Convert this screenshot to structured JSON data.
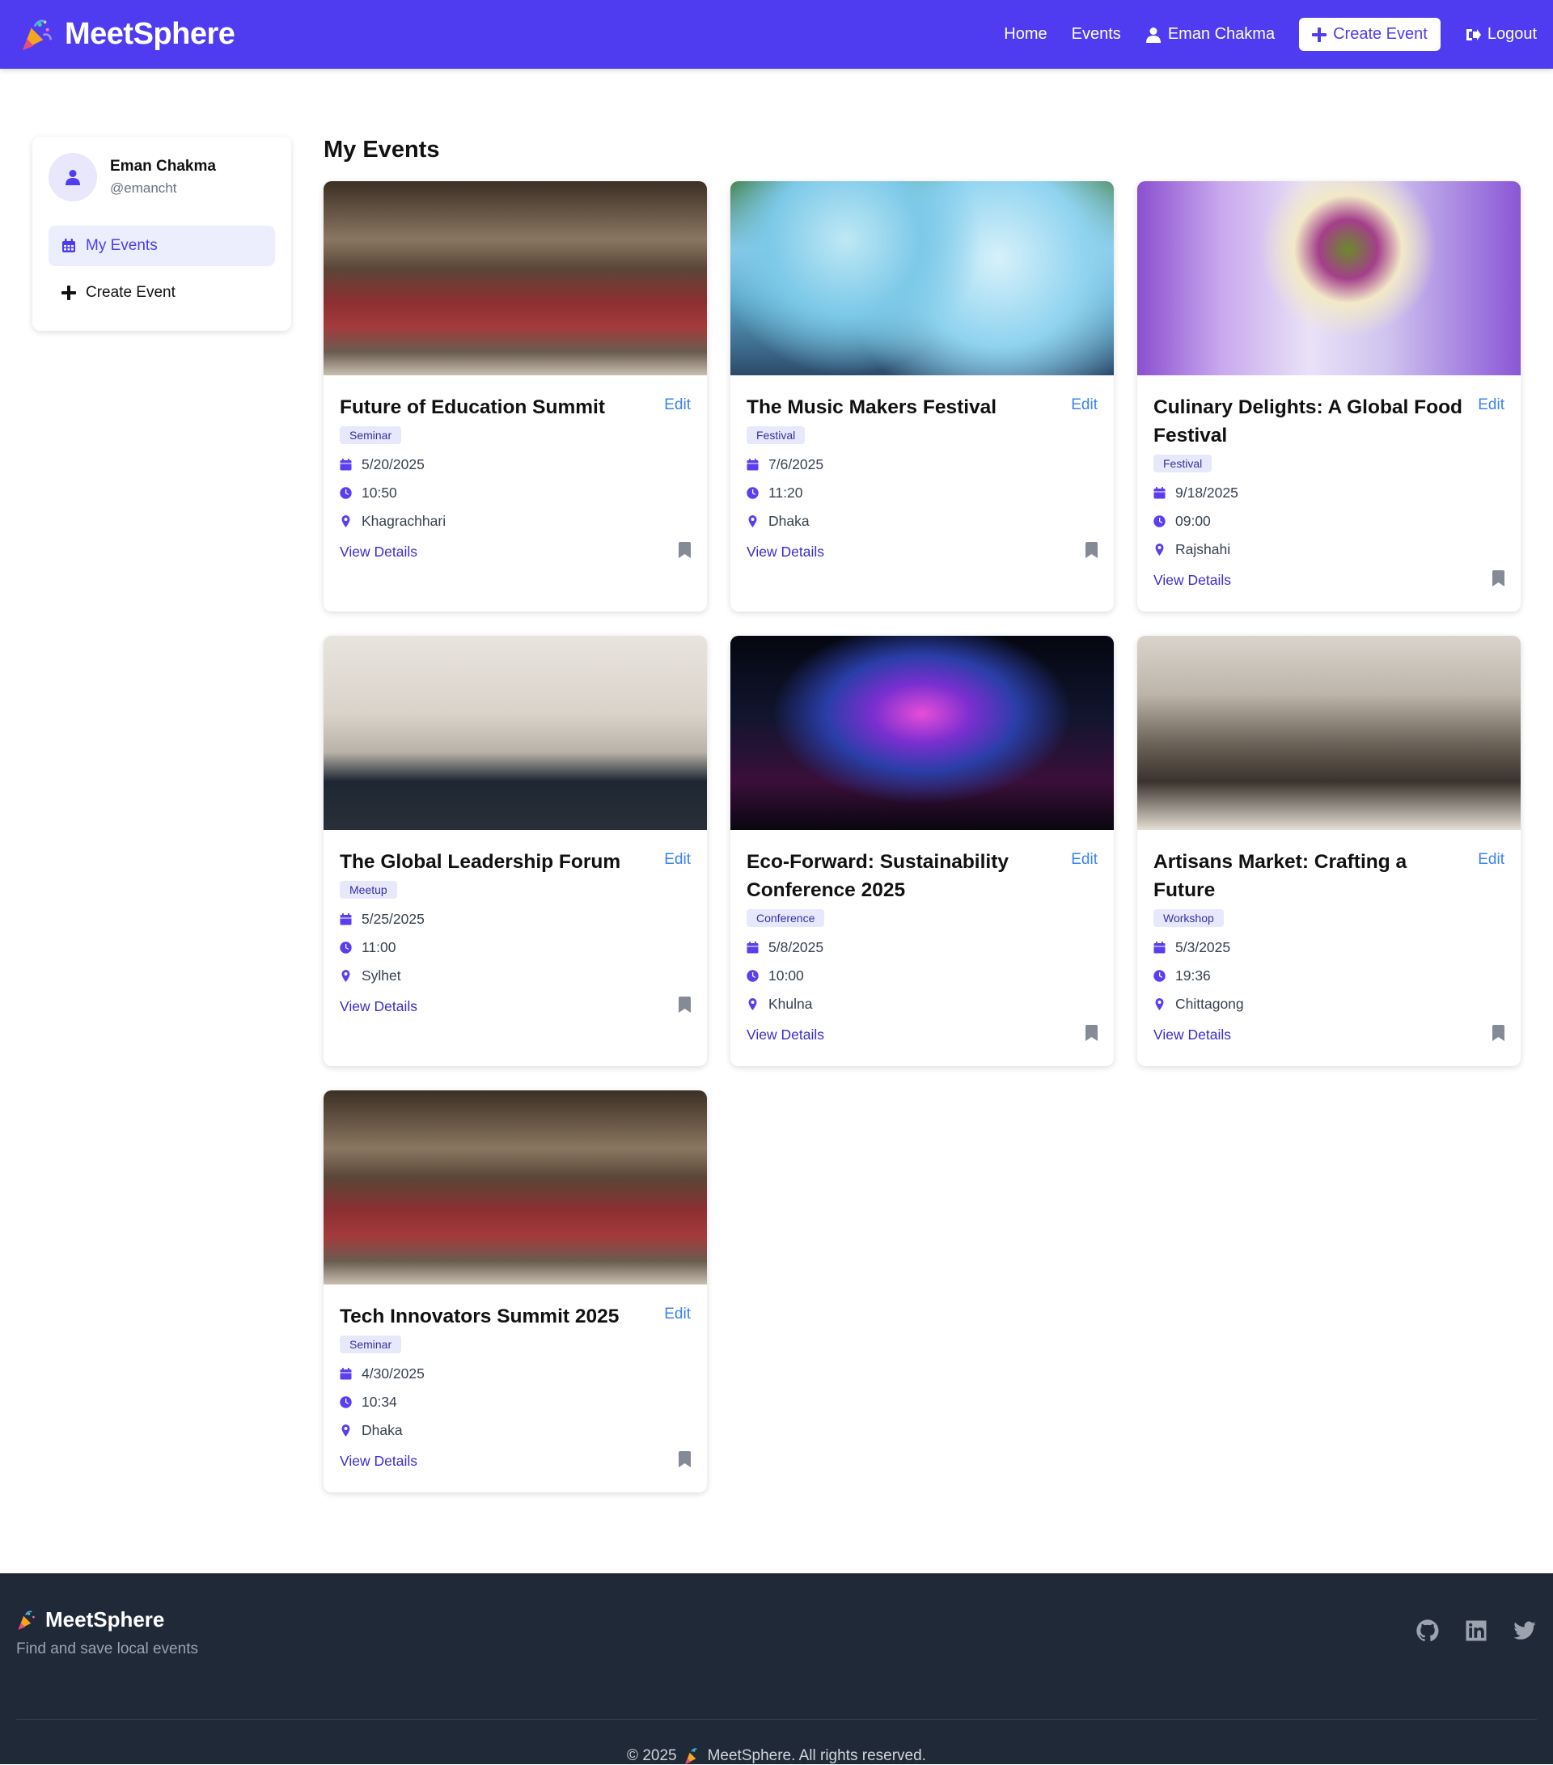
{
  "nav": {
    "brand": "MeetSphere",
    "links": {
      "home": "Home",
      "events": "Events",
      "user": "Eman Chakma",
      "create": "Create Event",
      "logout": "Logout"
    }
  },
  "sidebar": {
    "user_name": "Eman Chakma",
    "user_handle": "@emancht",
    "items": [
      {
        "label": "My Events",
        "icon": "calendar-icon",
        "active": true
      },
      {
        "label": "Create Event",
        "icon": "plus-icon",
        "active": false
      }
    ]
  },
  "main": {
    "title": "My Events",
    "edit_label": "Edit",
    "view_label": "View Details",
    "events": [
      {
        "title": "Future of Education Summit",
        "category": "Seminar",
        "date": "5/20/2025",
        "time": "10:50",
        "location": "Khagrachhari",
        "image": "auditorium"
      },
      {
        "title": "The Music Makers Festival",
        "category": "Festival",
        "date": "7/6/2025",
        "time": "11:20",
        "location": "Dhaka",
        "image": "color-festival"
      },
      {
        "title": "Culinary Delights: A Global Food Festival",
        "category": "Festival",
        "date": "9/18/2025",
        "time": "09:00",
        "location": "Rajshahi",
        "image": "flower-bouquet"
      },
      {
        "title": "The Global Leadership Forum",
        "category": "Meetup",
        "date": "5/25/2025",
        "time": "11:00",
        "location": "Sylhet",
        "image": "gallery-talk"
      },
      {
        "title": "Eco-Forward: Sustainability Conference 2025",
        "category": "Conference",
        "date": "5/8/2025",
        "time": "10:00",
        "location": "Khulna",
        "image": "concert-stage"
      },
      {
        "title": "Artisans Market: Crafting a Future",
        "category": "Workshop",
        "date": "5/3/2025",
        "time": "19:36",
        "location": "Chittagong",
        "image": "banquet-hall"
      },
      {
        "title": "Tech Innovators Summit 2025",
        "category": "Seminar",
        "date": "4/30/2025",
        "time": "10:34",
        "location": "Dhaka",
        "image": "auditorium"
      }
    ]
  },
  "footer": {
    "brand": "MeetSphere",
    "tagline": "Find and save local events",
    "copyright_prefix": "© 2025",
    "copyright_suffix": "MeetSphere. All rights reserved.",
    "icons": [
      "github-icon",
      "linkedin-icon",
      "twitter-icon"
    ]
  },
  "colors": {
    "primary": "#4f3cf0",
    "footer_bg": "#1f2937",
    "link": "#3b82f6"
  }
}
